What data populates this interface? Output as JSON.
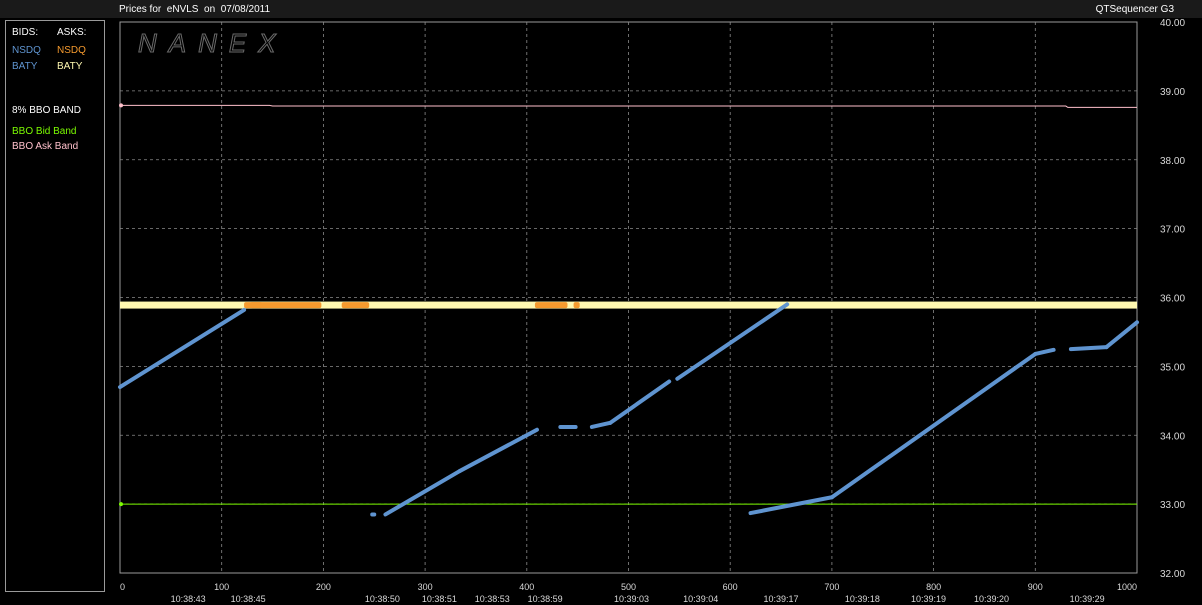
{
  "header": {
    "title": "Prices for  eNVLS  on  07/08/2011",
    "app": "QTSequencer G3"
  },
  "watermark": "NANEX",
  "legend": {
    "bids_label": "BIDS:",
    "asks_label": "ASKS:",
    "bids": [
      {
        "name": "NSDQ",
        "color": "#5f94d0"
      },
      {
        "name": "BATY",
        "color": "#5f94d0"
      }
    ],
    "asks": [
      {
        "name": "NSDQ",
        "color": "#f59a2e"
      },
      {
        "name": "BATY",
        "color": "#fff8b0"
      }
    ],
    "band_title": "8% BBO BAND",
    "bid_band": {
      "name": "BBO Bid Band",
      "color": "#7cfc00"
    },
    "ask_band": {
      "name": "BBO Ask Band",
      "color": "#ffc0cb"
    }
  },
  "chart_data": {
    "type": "scatter",
    "xlim": [
      0,
      1000
    ],
    "ylim": [
      32.0,
      40.0
    ],
    "x_ticks": [
      "0",
      "100",
      "200",
      "300",
      "400",
      "500",
      "600",
      "700",
      "800",
      "900",
      "1000"
    ],
    "y_ticks": [
      "32.00",
      "33.00",
      "34.00",
      "35.00",
      "36.00",
      "37.00",
      "38.00",
      "39.00",
      "40.00"
    ],
    "time_labels": [
      {
        "x": 67,
        "label": "10:38:43"
      },
      {
        "x": 126,
        "label": "10:38:45"
      },
      {
        "x": 258,
        "label": "10:38:50"
      },
      {
        "x": 314,
        "label": "10:38:51"
      },
      {
        "x": 366,
        "label": "10:38:53"
      },
      {
        "x": 418,
        "label": "10:38:59"
      },
      {
        "x": 503,
        "label": "10:39:03"
      },
      {
        "x": 571,
        "label": "10:39:04"
      },
      {
        "x": 650,
        "label": "10:39:17"
      },
      {
        "x": 730,
        "label": "10:39:18"
      },
      {
        "x": 795,
        "label": "10:39:19"
      },
      {
        "x": 857,
        "label": "10:39:20"
      },
      {
        "x": 951,
        "label": "10:39:29"
      }
    ],
    "bid_band": {
      "y": 33.0,
      "x_start": 0,
      "x_end": 1000
    },
    "ask_band": {
      "points": [
        [
          0,
          38.79
        ],
        [
          147,
          38.79
        ],
        [
          150,
          38.78
        ],
        [
          930,
          38.78
        ],
        [
          932,
          38.76
        ],
        [
          1000,
          38.76
        ]
      ]
    },
    "ask_baty": {
      "y": 35.89,
      "x_start": 0,
      "x_end": 1000
    },
    "ask_nsdq": {
      "y": 35.89,
      "segments": [
        [
          122,
          198
        ],
        [
          218,
          245
        ],
        [
          408,
          440
        ],
        [
          128,
          140
        ],
        [
          446,
          452
        ]
      ]
    },
    "bid_segments": [
      {
        "x0": 0,
        "y0": 34.7,
        "x1": 122,
        "y1": 35.82
      },
      {
        "x0": 248,
        "y0": 32.85,
        "x1": 250,
        "y1": 32.85
      },
      {
        "x0": 261,
        "y0": 32.85,
        "x1": 334,
        "y1": 33.48
      },
      {
        "x0": 334,
        "y0": 33.48,
        "x1": 410,
        "y1": 34.08
      },
      {
        "x0": 433,
        "y0": 34.12,
        "x1": 448,
        "y1": 34.12
      },
      {
        "x0": 464,
        "y0": 34.12,
        "x1": 482,
        "y1": 34.18
      },
      {
        "x0": 482,
        "y0": 34.18,
        "x1": 540,
        "y1": 34.78
      },
      {
        "x0": 548,
        "y0": 34.82,
        "x1": 656,
        "y1": 35.9
      },
      {
        "x0": 620,
        "y0": 32.87,
        "x1": 700,
        "y1": 33.1
      },
      {
        "x0": 700,
        "y0": 33.1,
        "x1": 900,
        "y1": 35.18
      },
      {
        "x0": 900,
        "y0": 35.18,
        "x1": 918,
        "y1": 35.24
      },
      {
        "x0": 935,
        "y0": 35.25,
        "x1": 970,
        "y1": 35.28
      },
      {
        "x0": 970,
        "y0": 35.28,
        "x1": 1000,
        "y1": 35.64
      }
    ]
  }
}
